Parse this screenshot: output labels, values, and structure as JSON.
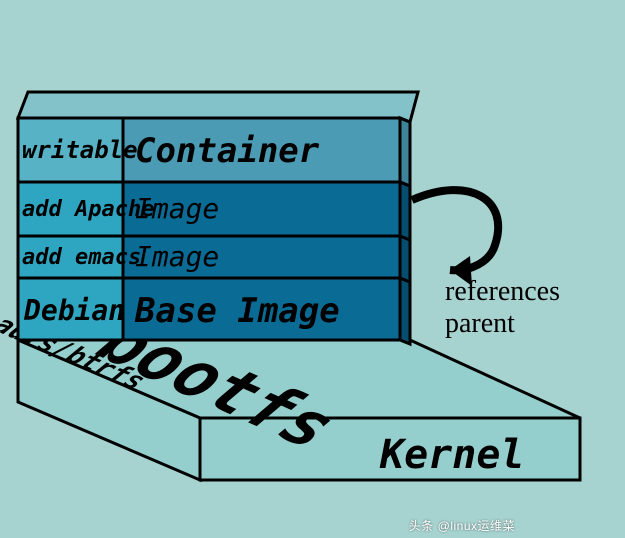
{
  "layers": {
    "container": {
      "left": "writable",
      "right": "Container"
    },
    "apache": {
      "left": "add Apache",
      "right": "Image"
    },
    "emacs": {
      "left": "add emacs",
      "right": "Image"
    },
    "base": {
      "left": "Debian",
      "right": "Base Image"
    }
  },
  "platform": {
    "left": "lxc, aufs/btrfs",
    "front": "bootfs",
    "right": "Kernel"
  },
  "arrow_label": {
    "line1": "references",
    "line2": "parent"
  },
  "watermark": "头条 @linux运维菜",
  "colors": {
    "bg": "#a6d3d0",
    "light_teal": "#95cfcd",
    "mid_teal": "#2ea6c2",
    "dark_teal": "#0a6b95",
    "stroke": "#000000"
  }
}
